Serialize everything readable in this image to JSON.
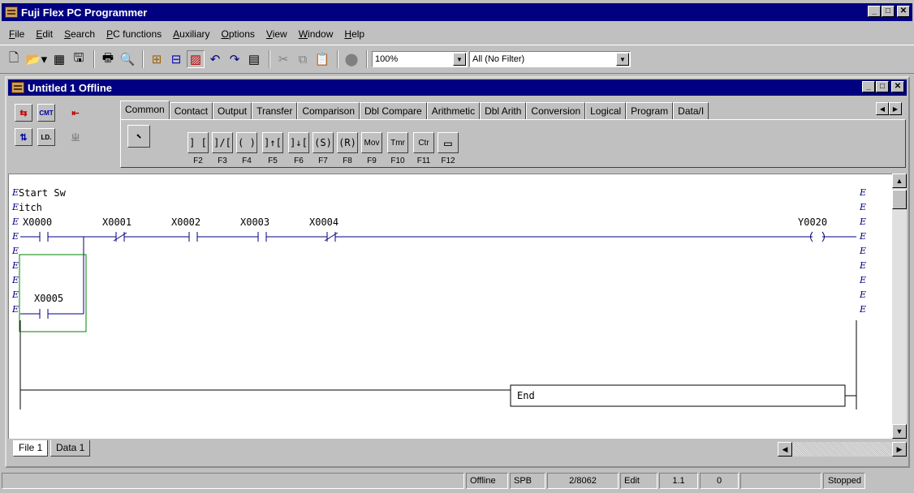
{
  "app": {
    "title": "Fuji Flex PC Programmer"
  },
  "menu": [
    {
      "label": "File",
      "accel": "F"
    },
    {
      "label": "Edit",
      "accel": "E"
    },
    {
      "label": "Search",
      "accel": "S"
    },
    {
      "label": "PC functions",
      "accel": "P"
    },
    {
      "label": "Auxiliary",
      "accel": "A"
    },
    {
      "label": "Options",
      "accel": "O"
    },
    {
      "label": "View",
      "accel": "V"
    },
    {
      "label": "Window",
      "accel": "W"
    },
    {
      "label": "Help",
      "accel": "H"
    }
  ],
  "toolbar": {
    "zoom_value": "100%",
    "filter_value": "All (No Filter)"
  },
  "child_window": {
    "title": "Untitled 1 Offline"
  },
  "palette": {
    "tabs": [
      "Common",
      "Contact",
      "Output",
      "Transfer",
      "Comparison",
      "Dbl Compare",
      "Arithmetic",
      "Dbl Arith",
      "Conversion",
      "Logical",
      "Program",
      "Data/I"
    ],
    "active_tab": "Common",
    "buttons": [
      {
        "glyph": "] [",
        "key": "F2"
      },
      {
        "glyph": "]/[",
        "key": "F3"
      },
      {
        "glyph": "( )",
        "key": "F4"
      },
      {
        "glyph": "]↑[",
        "key": "F5"
      },
      {
        "glyph": "]↓[",
        "key": "F6"
      },
      {
        "glyph": "(S)",
        "key": "F7"
      },
      {
        "glyph": "(R)",
        "key": "F8"
      },
      {
        "glyph": "Mov",
        "key": "F9"
      },
      {
        "glyph": "Tmr",
        "key": "F10"
      },
      {
        "glyph": "Ctr",
        "key": "F11"
      },
      {
        "glyph": "▭",
        "key": "F12"
      }
    ],
    "left_tools": [
      "CMT",
      "LD.",
      "ㄓ"
    ]
  },
  "ladder": {
    "comment_lines": [
      "Start Sw",
      "itch"
    ],
    "e_marker": "E",
    "contacts": [
      "X0000",
      "X0001",
      "X0002",
      "X0003",
      "X0004"
    ],
    "output_coil": "Y0020",
    "branch_contact": "X0005",
    "end_label": "End"
  },
  "sheets": [
    "File 1",
    "Data 1"
  ],
  "status": {
    "mode": "Offline",
    "cpu": "SPB",
    "steps": "2/8062",
    "edit_mode": "Edit",
    "version": "1.1",
    "count": "0",
    "run_state": "Stopped"
  }
}
